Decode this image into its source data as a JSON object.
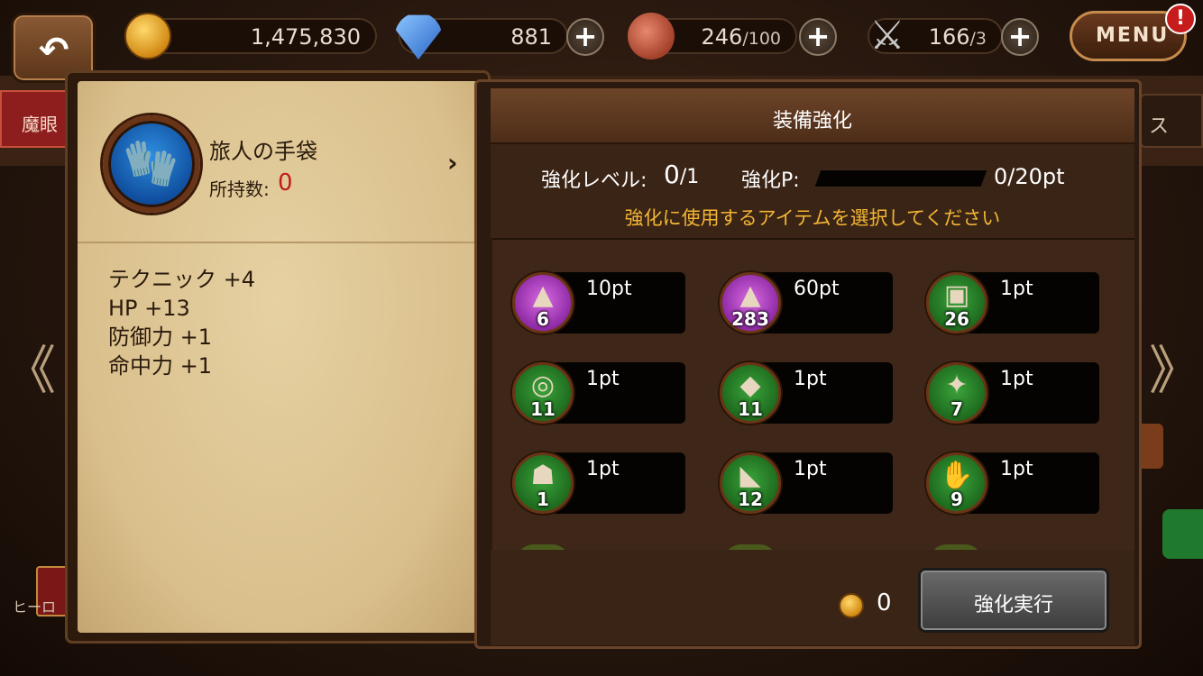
{
  "hud": {
    "gold": "1,475,830",
    "gems": "881",
    "stamina": "246",
    "stamina_max": "/100",
    "battle": "166",
    "battle_max": "/3",
    "plus": "+",
    "menu": "MENU",
    "alert": "!",
    "back": "↶"
  },
  "background": {
    "left_tab": "魔眼",
    "right_tab": "ス",
    "arrow_left": "《",
    "arrow_right": "》",
    "hero_label": "ヒーロ"
  },
  "item": {
    "name": "旅人の手袋",
    "owned_label": "所持数:",
    "owned_value": "0",
    "chevron": "›",
    "stats": [
      "テクニック +4",
      "HP +13",
      "防御力 +1",
      "命中力 +1"
    ]
  },
  "enhance": {
    "title": "装備強化",
    "level_label": "強化レベル:",
    "level_value": "0",
    "level_max": "/1",
    "points_label": "強化P:",
    "points_value": "0/20pt",
    "points_fill": 0,
    "hint": "強化に使用するアイテムを選択してください",
    "materials": [
      {
        "pt": "10pt",
        "count": "6",
        "color": "purple",
        "icon": "salt-pile-icon"
      },
      {
        "pt": "60pt",
        "count": "283",
        "color": "purple",
        "icon": "salt-pile-icon"
      },
      {
        "pt": "1pt",
        "count": "26",
        "color": "green",
        "icon": "leather-armor-icon"
      },
      {
        "pt": "1pt",
        "count": "11",
        "color": "green",
        "icon": "belt-icon"
      },
      {
        "pt": "1pt",
        "count": "11",
        "color": "green",
        "icon": "wood-shield-icon"
      },
      {
        "pt": "1pt",
        "count": "7",
        "color": "green",
        "icon": "dagger-icon"
      },
      {
        "pt": "1pt",
        "count": "1",
        "color": "green",
        "icon": "leather-hood-icon"
      },
      {
        "pt": "1pt",
        "count": "12",
        "color": "green",
        "icon": "boots-icon"
      },
      {
        "pt": "1pt",
        "count": "9",
        "color": "green",
        "icon": "gloves-icon"
      }
    ],
    "cost": "0",
    "execute": "強化実行"
  },
  "colors": {
    "accent_hint": "#f2b534",
    "owned_red": "#c01c1c",
    "panel": "#2a1a10",
    "parchment": "#e6d1a3"
  }
}
